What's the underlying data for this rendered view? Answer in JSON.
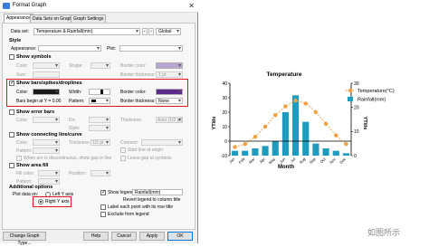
{
  "dialog": {
    "title": "Format Graph",
    "tabs": [
      "Appearance",
      "Data Sets on Graph",
      "Graph Settings"
    ],
    "active_tab": 0,
    "data_set_label": "Data set:",
    "data_set_value": "Temperature & Rainfall(mm)",
    "global_value": "Global",
    "style_section": "Style",
    "appearance_label": "Appearance:",
    "plot_label": "Plot:",
    "show_symbols": "Show symbols",
    "symbols": {
      "color": "Color:",
      "shape": "Shape:",
      "border_color": "Border color:",
      "size": "Size:",
      "border_thickness": "Border thickness:",
      "thickness_value": "1 pt"
    },
    "show_bars": "Show bars/spikes/droplines",
    "bars": {
      "color": "Color:",
      "width": "Width:",
      "border_color": "Border color:",
      "begin_label": "Bars begin at Y = 0.00",
      "pattern": "Pattern:",
      "border_thickness": "Border thickness:",
      "thickness_value": "None"
    },
    "show_error_bars": "Show error bars",
    "error": {
      "color": "Color:",
      "dir": "Dir:",
      "style": "Style:",
      "thickness": "Thickness:",
      "thickness_value": "Auto (1/2 pt)"
    },
    "show_connecting": "Show connecting line/curve",
    "connecting": {
      "color": "Color:",
      "thickness": "Thickness:",
      "thickness_value": "1/2 pt",
      "connect": "Connect:",
      "pattern": "Pattern:",
      "start_at_origin": "Start line at origin",
      "missing": "When are is discontinuous, show gap in line",
      "leave_gap": "Leave gap at symbols"
    },
    "show_area_fill": "Show area fill",
    "fill": {
      "fill_color": "Fill color:",
      "pattern": "Pattern:",
      "position": "Position:"
    },
    "additional_section": "Additional options",
    "plot_data_on": "Plot data on:",
    "left_axis": "Left Y axis",
    "right_axis": "Right Y axis",
    "show_legend": "Show legend",
    "legend_value": "Rainfall(mm)",
    "revert_legend": "Revert legend to column title",
    "label_each_point": "Label each point with its row title",
    "exclude_legend": "Exclude from legend",
    "buttons": {
      "change_type": "Change Graph Type...",
      "help": "Help",
      "cancel": "Cancel",
      "apply": "Apply",
      "ok": "OK"
    },
    "colors": {
      "symbol_color": "#b9a6d4",
      "bar_color": "#1a1a1a",
      "bar_border_color": "#5c2a8a",
      "highlight": "#e0161b"
    }
  },
  "chart_data": {
    "type": "bar",
    "title": "Temperature",
    "xlabel": "Month",
    "ylabel": "YTitle",
    "y2label": "YTitle",
    "categories": [
      "Jan",
      "Feb",
      "Mar",
      "Apr",
      "May",
      "Jun",
      "Jul",
      "Aug",
      "Sep",
      "Oct",
      "Nov",
      "Dec"
    ],
    "ylim": [
      -10,
      40
    ],
    "yticks": [
      -10,
      0,
      10,
      20,
      30,
      40
    ],
    "y2lim": [
      0,
      30
    ],
    "y2ticks": [
      0,
      10,
      20,
      30
    ],
    "series": [
      {
        "name": "Temperature(°C)",
        "kind": "line",
        "axis": "left",
        "color": "#f0a040",
        "values": [
          -4,
          -2,
          3,
          10,
          18,
          24,
          28,
          26,
          20,
          12,
          4,
          -2
        ]
      },
      {
        "name": "Rainfall(mm)",
        "kind": "bar",
        "axis": "right",
        "color": "#1f9bc0",
        "values": [
          2,
          2,
          3,
          4,
          6,
          18,
          25,
          14,
          5,
          3,
          2,
          1
        ]
      }
    ],
    "legend_position": "top-right",
    "grid": false
  },
  "watermark": "如图所示"
}
